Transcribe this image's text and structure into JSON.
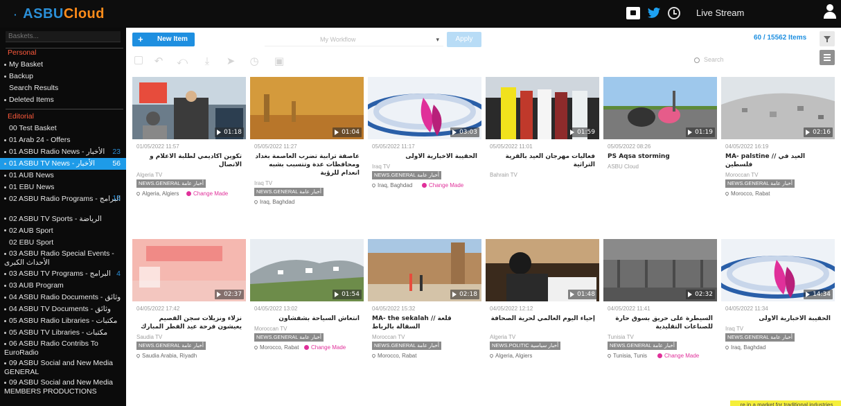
{
  "header": {
    "logo_text_a": "ASBU",
    "logo_text_b": "Cloud",
    "live_stream": "Live Stream"
  },
  "sidebar": {
    "search_placeholder": "Baskets...",
    "personal_head": "Personal",
    "personal_items": [
      {
        "label": "My Basket",
        "bullet": true
      },
      {
        "label": "Backup",
        "bullet": true
      },
      {
        "label": "Search Results",
        "bullet": false
      },
      {
        "label": "Deleted Items",
        "bullet": true
      }
    ],
    "editorial_head": "Editorial",
    "editorial_items": [
      {
        "label": "00 Test Basket",
        "bullet": false
      },
      {
        "label": "01 Arab 24 - Offers",
        "bullet": true
      },
      {
        "label": "01 ASBU Radio News - الأخبار",
        "bullet": true,
        "count": "23"
      },
      {
        "label": "01 ASBU TV News - الأخبار",
        "bullet": true,
        "count": "56",
        "active": true
      },
      {
        "label": "01 AUB News",
        "bullet": true
      },
      {
        "label": "01 EBU News",
        "bullet": true
      },
      {
        "label": "02 ASBU Radio Programs - البرامج",
        "bullet": true,
        "count": "15",
        "two": true
      },
      {
        "label": "02 ASBU TV Sports - الرياضة",
        "bullet": true
      },
      {
        "label": "02 AUB Sport",
        "bullet": true
      },
      {
        "label": "02 EBU Sport",
        "bullet": false
      },
      {
        "label": "03 ASBU Radio Special Events - الأحداث الكبرى",
        "bullet": true,
        "two": true
      },
      {
        "label": "03 ASBU TV Programs - البرامج",
        "bullet": true,
        "count": "4"
      },
      {
        "label": "03 AUB Program",
        "bullet": true
      },
      {
        "label": "04 ASBU Radio Documents - وثائق",
        "bullet": true
      },
      {
        "label": "04 ASBU TV Documents - وثائق",
        "bullet": true
      },
      {
        "label": "05 ASBU Radio Libraries - مكتبات",
        "bullet": true
      },
      {
        "label": "05 ASBU TV Libraries - مكتبات",
        "bullet": true
      },
      {
        "label": "06 ASBU Radio Contribs To EuroRadio",
        "bullet": true,
        "two": true
      },
      {
        "label": "09 ASBU Social and New Media GENERAL",
        "bullet": true,
        "two": true
      },
      {
        "label": "09 ASBU Social and New Media MEMBERS PRODUCTIONS",
        "bullet": true,
        "two": true
      }
    ]
  },
  "toolbar": {
    "new_item": "New Item",
    "workflow_placeholder": "My Workflow",
    "apply": "Apply",
    "items_count": "60 / 15562 Items",
    "search_placeholder": "Search"
  },
  "colors": {
    "accent": "#1e8fe0",
    "active_sidebar": "#1e9be8",
    "sidebar_head": "#ff5a3c",
    "change_made": "#e0309a",
    "logo_cloud": "#ff8c1a"
  },
  "cards": [
    {
      "duration": "01:18",
      "date": "01/05/2022 11:57",
      "title": "تكوين اكاديمي لطلبة الاعلام و الاتصال",
      "rtl": true,
      "channel": "Algeria TV",
      "tag": "NEWS.GENERAL أخبار عامة",
      "location": "Algeria, Algiers",
      "change": "Change Made",
      "thumb": "conference"
    },
    {
      "duration": "01:04",
      "date": "05/05/2022 11:27",
      "title": "عاصفة ترابية تضرب العاصمة بغداد ومحافظات عدة وتتسبب بشبه انعدام للرؤية",
      "rtl": true,
      "channel": "Iraq TV",
      "tag": "NEWS.GENERAL أخبار عامة",
      "location": "Iraq, Baghdad",
      "change": "",
      "thumb": "dust"
    },
    {
      "duration": "03:03",
      "date": "05/05/2022 11:17",
      "title": "الحقيبة الاخبارية الاولى",
      "rtl": true,
      "channel": "Iraq TV",
      "tag": "NEWS.GENERAL أخبار عامة",
      "location": "Iraq, Baghdad",
      "change": "Change Made",
      "thumb": "ribbon"
    },
    {
      "duration": "01:59",
      "date": "05/05/2022 11:01",
      "title": "فعاليات مهرجان العيد بالقرية التراثية",
      "rtl": true,
      "channel": "Bahrain TV",
      "tag": "",
      "location": "",
      "change": "",
      "thumb": "festival"
    },
    {
      "duration": "01:19",
      "date": "05/05/2022 08:26",
      "title": "PS Aqsa storming",
      "rtl": false,
      "channel": "ASBU Cloud",
      "tag": "",
      "location": "",
      "change": "",
      "thumb": "road"
    },
    {
      "duration": "02:16",
      "date": "04/05/2022 16:19",
      "title": "MA- palstine // العيد في فلسطين",
      "rtl": false,
      "channel": "Moroccan TV",
      "tag": "NEWS.GENERAL أخبار عامة",
      "location": "Morocco, Rabat",
      "change": "",
      "thumb": "city"
    },
    {
      "duration": "02:37",
      "date": "04/05/2022 17:42",
      "title": "نزلاء ونزيلات سجن القصيم يعيشون فرحة عيد الفطر المبارك",
      "rtl": true,
      "channel": "Saudia TV",
      "tag": "NEWS.GENERAL أخبار عامة",
      "location": "Saudia Arabia, Riyadh",
      "change": "",
      "thumb": "pink"
    },
    {
      "duration": "01:54",
      "date": "04/05/2022 13:02",
      "title": "انتعاش السياحة بشفشاون",
      "rtl": true,
      "channel": "Moroccan TV",
      "tag": "NEWS.GENERAL أخبار عامة",
      "location": "Morocco, Rabat",
      "change": "Change Made",
      "thumb": "hills"
    },
    {
      "duration": "02:18",
      "date": "04/05/2022 15:32",
      "title": "MA- the sekalah // قلعة السقالة بالرباط",
      "rtl": false,
      "channel": "Moroccan TV",
      "tag": "NEWS.GENERAL أخبار عامة",
      "location": "Morocco, Rabat",
      "change": "",
      "thumb": "fort"
    },
    {
      "duration": "01:48",
      "date": "04/05/2022 12:12",
      "title": "إحياء اليوم العالمي لحرية الصحافة",
      "rtl": true,
      "channel": "Algeria TV",
      "tag": "NEWS.POLITIC أخبار سياسية",
      "location": "Algeria, Algiers",
      "change": "",
      "thumb": "press"
    },
    {
      "duration": "02:32",
      "date": "04/05/2022 11:41",
      "title": "السيطرة على حريق بسوق حارة للصناعات التقليدية",
      "rtl": true,
      "channel": "Tunisia TV",
      "tag": "NEWS.GENERAL أخبار عامة",
      "location": "Tunisia, Tunis",
      "change": "Change Made",
      "thumb": "fire"
    },
    {
      "duration": "14:34",
      "date": "04/05/2022 11:34",
      "title": "الحقيبة الاخبارية الاولى",
      "rtl": true,
      "channel": "Iraq TV",
      "tag": "NEWS.GENERAL أخبار عامة",
      "location": "Iraq, Baghdad",
      "change": "",
      "thumb": "ribbon"
    }
  ],
  "highlight_text": "...re in a market for traditional industries"
}
